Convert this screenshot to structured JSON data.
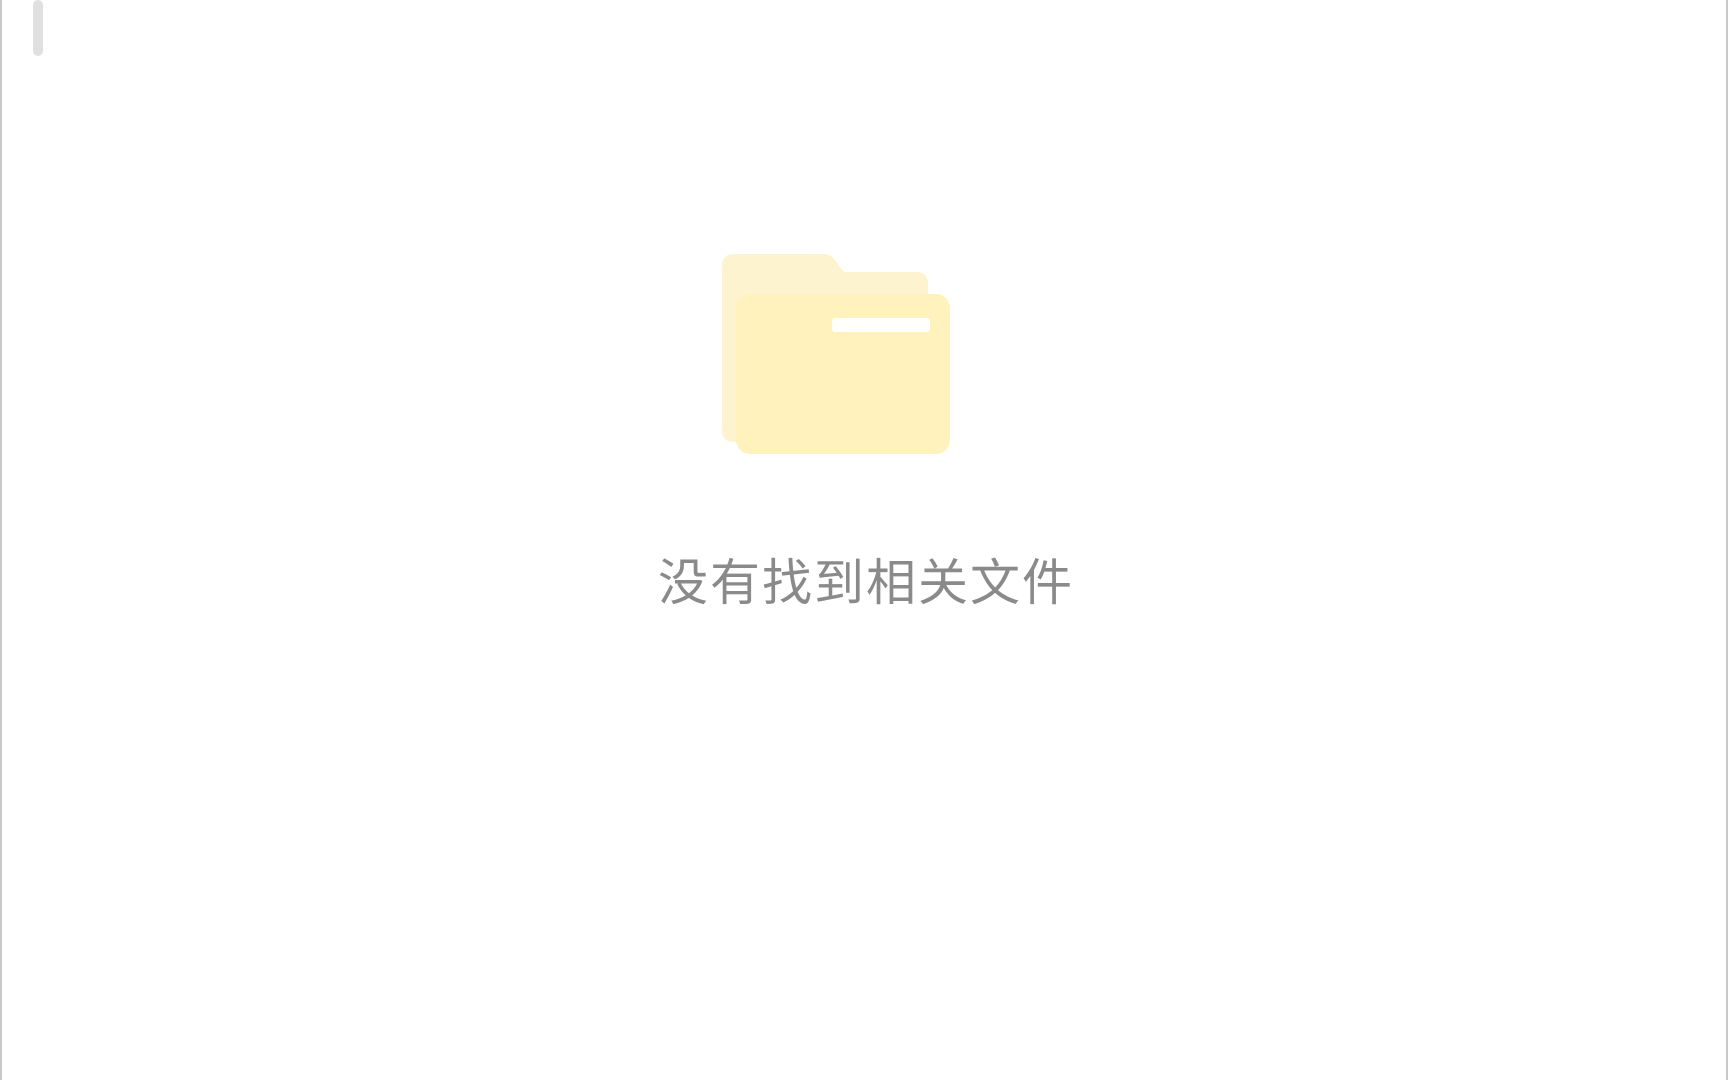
{
  "empty_state": {
    "message": "没有找到相关文件",
    "icon": "folder-icon"
  },
  "colors": {
    "folder_back": "#fdf3cf",
    "folder_front": "#fff2bd",
    "folder_tab_line": "#ffffff",
    "message_text": "#8a8a8a",
    "scrollbar": "#e0e0e0",
    "window_border": "#c9c9c9"
  }
}
